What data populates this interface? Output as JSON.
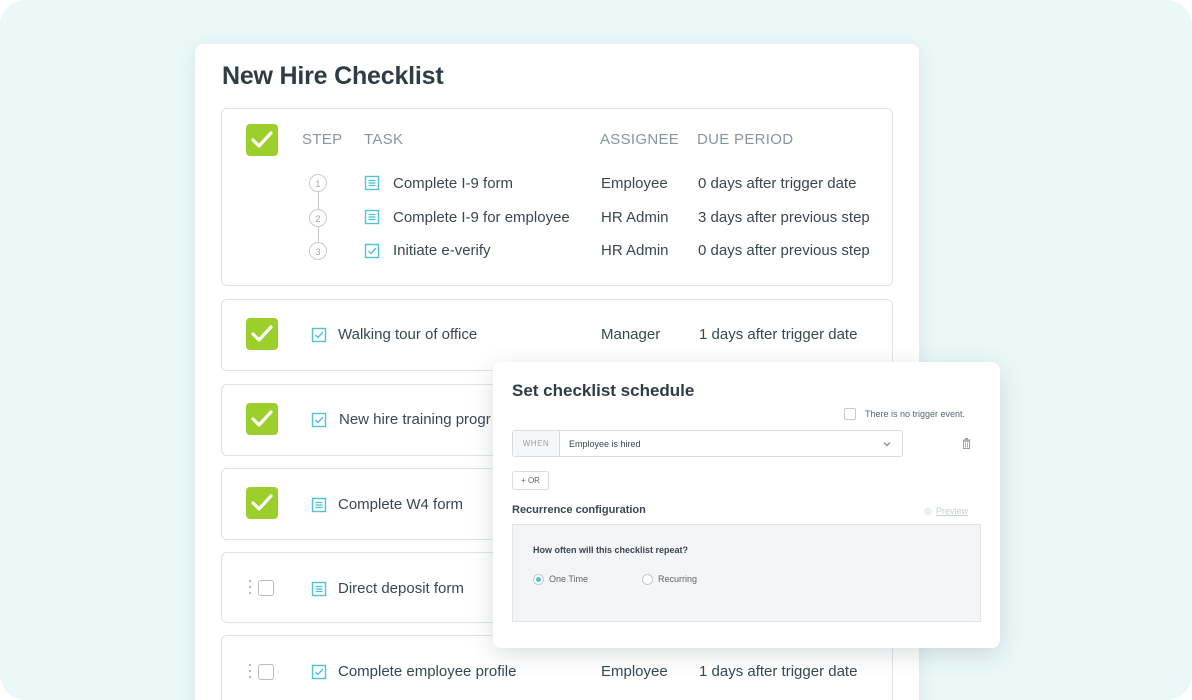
{
  "card": {
    "title": "New Hire Checklist"
  },
  "group": {
    "headers": {
      "step": "STEP",
      "task": "TASK",
      "assignee": "ASSIGNEE",
      "due": "DUE PERIOD"
    },
    "steps": [
      {
        "num": "1",
        "task": "Complete I-9 form",
        "icon": "document-icon",
        "assignee": "Employee",
        "due": "0 days after trigger date"
      },
      {
        "num": "2",
        "task": "Complete I-9 for employee",
        "icon": "document-icon",
        "assignee": "HR Admin",
        "due": "3 days after previous step"
      },
      {
        "num": "3",
        "task": "Initiate e-verify",
        "icon": "checkbox-task-icon",
        "assignee": "HR Admin",
        "due": "0 days after previous step"
      }
    ]
  },
  "rows": [
    {
      "task": "Walking tour of office",
      "icon": "checkbox-task-icon",
      "checked": true,
      "assignee": "Manager",
      "due": "1 days after trigger date"
    },
    {
      "task": "New hire training progr",
      "icon": "checkbox-task-icon",
      "checked": true
    },
    {
      "task": "Complete W4 form",
      "icon": "document-icon",
      "checked": true
    },
    {
      "task": "Direct deposit form",
      "icon": "document-icon",
      "checked": false
    },
    {
      "task": "Complete employee profile",
      "icon": "checkbox-task-icon",
      "checked": false,
      "assignee": "Employee",
      "due": "1 days after trigger date"
    }
  ],
  "modal": {
    "title": "Set checklist schedule",
    "no_trigger_label": "There is no trigger event.",
    "when_tag": "WHEN",
    "when_value": "Employee is hired",
    "or_label": "+ OR",
    "recurrence_title": "Recurrence configuration",
    "preview_label": "Preview",
    "question": "How often will this checklist repeat?",
    "options": [
      "One Time",
      "Recurring"
    ],
    "selected_option": "One Time"
  },
  "colors": {
    "check_green": "#9ccf2c",
    "icon_teal": "#4fc3d0",
    "background": "#eaf8f8"
  }
}
